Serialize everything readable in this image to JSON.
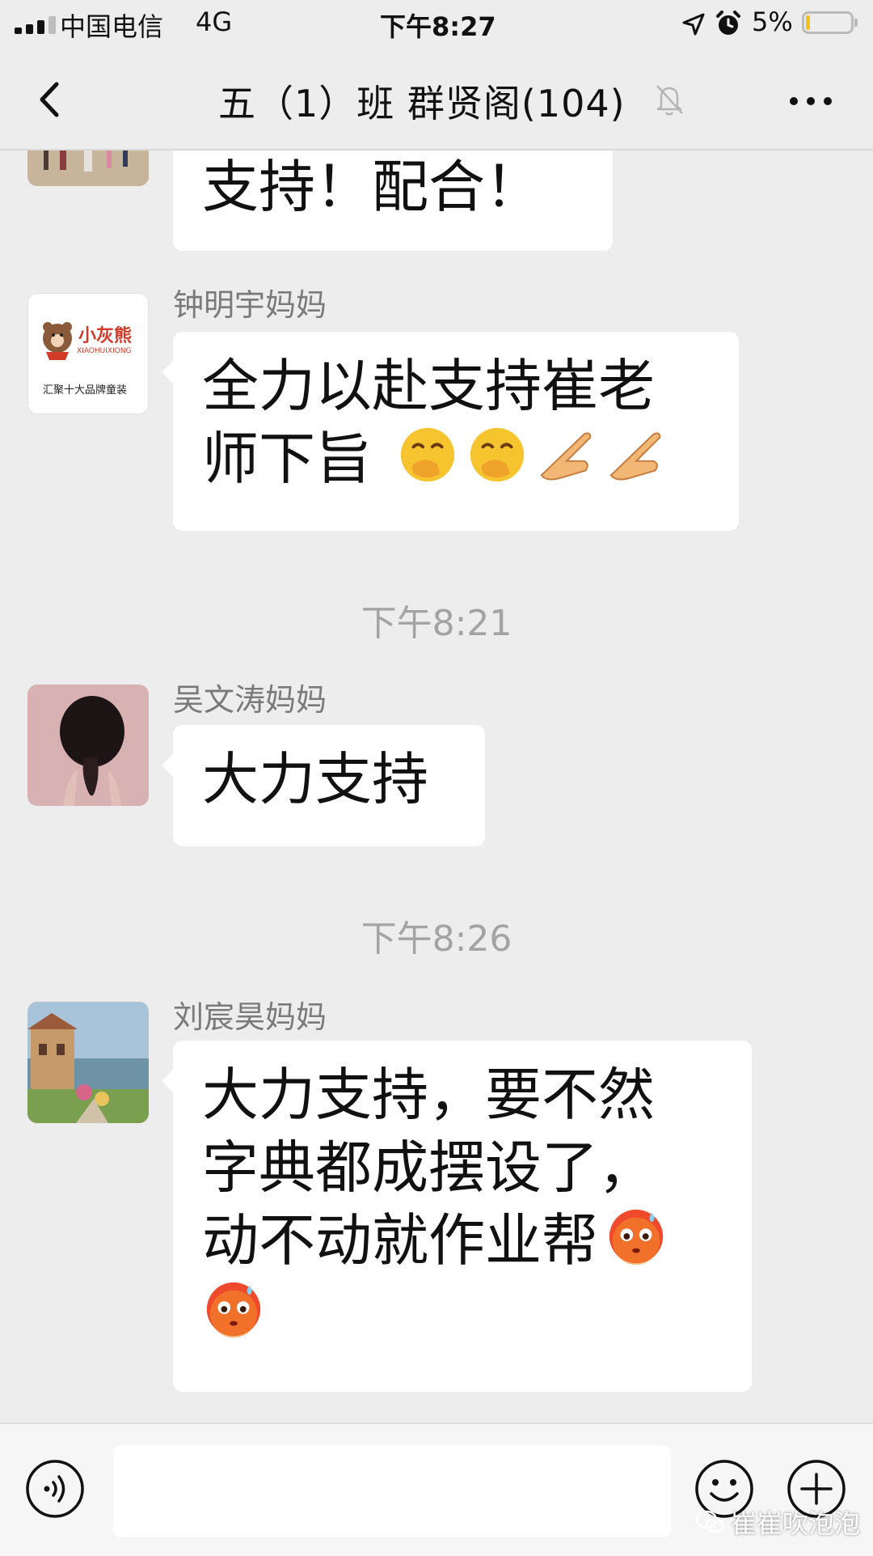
{
  "status_bar": {
    "carrier": "中国电信",
    "network": "4G",
    "time": "下午8:27",
    "battery_percent": "5%",
    "battery_level": 0.05,
    "icons": [
      "signal-icon",
      "location-arrow-icon",
      "alarm-icon",
      "battery-icon"
    ]
  },
  "nav": {
    "title": "五（1）班   群贤阁(104)",
    "back_icon": "chevron-left-icon",
    "mute_icon": "bell-muted-icon",
    "more_icon": "more-dots-icon"
  },
  "messages": [
    {
      "sender": "",
      "avatar": "beach-photo",
      "text_lines": [
        "支持！配合！"
      ],
      "emojis": []
    },
    {
      "sender": "钟明宇妈妈",
      "avatar": "brand-logo",
      "avatar_logo": {
        "title": "小灰熊",
        "romanized": "XIAOHUIXIONG",
        "caption": "汇聚十大品牌童装"
      },
      "text_lines": [
        "全力以赴支持崔老",
        "师下旨"
      ],
      "emojis": [
        "hand-over-mouth",
        "hand-over-mouth",
        "pointing-hand",
        "pointing-hand"
      ]
    },
    {
      "timestamp": "下午8:21"
    },
    {
      "sender": "吴文涛妈妈",
      "avatar": "girl-braid-photo",
      "text_lines": [
        "大力支持"
      ],
      "emojis": []
    },
    {
      "timestamp": "下午8:26"
    },
    {
      "sender": "刘宸昊妈妈",
      "avatar": "village-painting",
      "text_lines": [
        "大力支持，要不然",
        "字典都成摆设了，",
        "动不动就作业帮"
      ],
      "emojis": [
        "flushed-sweat-face",
        "flushed-sweat-face"
      ]
    }
  ],
  "input_bar": {
    "voice_icon": "voice-icon",
    "emoji_icon": "smiley-icon",
    "add_icon": "plus-circle-icon",
    "input_value": ""
  },
  "watermark": "崔崔吹泡泡",
  "colors": {
    "background": "#ededed",
    "bubble": "#ffffff",
    "sender_text": "#7a7a7a",
    "timestamp_text": "#a3a3a3"
  }
}
